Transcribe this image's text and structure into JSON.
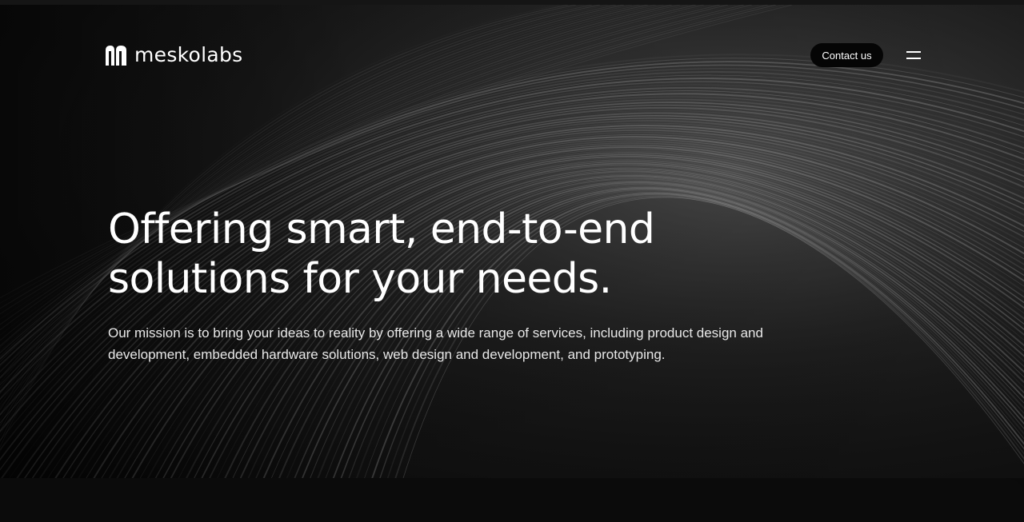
{
  "brand": {
    "name": "meskolabs",
    "logo_icon": "meskolabs-logo-mark"
  },
  "header": {
    "contact_label": "Contact us",
    "menu_icon": "hamburger-menu-icon"
  },
  "hero": {
    "headline_line1": "Offering smart, end-to-end",
    "headline_line2": "solutions for your needs.",
    "mission_line1": "Our mission is to bring your ideas to reality by offering a wide range of services, including product design and",
    "mission_line2": "development, embedded hardware solutions, web design and development, and prototyping."
  },
  "colors": {
    "background": "#0a0a0a",
    "text": "#ffffff",
    "button_bg": "#050505"
  }
}
